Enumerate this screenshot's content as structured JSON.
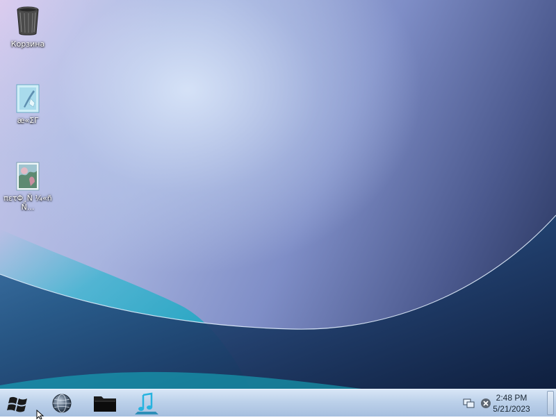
{
  "desktop": {
    "icons": [
      {
        "label": "Корзина",
        "icon": "recycle-bin-icon"
      },
      {
        "label": "æ«ΣΓ",
        "icon": "document-icon"
      },
      {
        "label": "πετΦ¸Ñ ¼«ñÑ...",
        "icon": "image-file-icon"
      }
    ]
  },
  "taskbar": {
    "start_icon": "windows-logo-icon",
    "pinned": [
      {
        "icon": "globe-browser-icon"
      },
      {
        "icon": "folder-icon"
      },
      {
        "icon": "music-note-icon"
      }
    ],
    "tray": {
      "icons": [
        "network-icon",
        "close-circle-icon"
      ],
      "time": "2:48 PM",
      "date": "5/21/2023"
    }
  },
  "colors": {
    "taskbar": "#bcd1ea",
    "clock_text": "#1b2733",
    "desktop_dark": "#1e2b50",
    "desktop_teal": "#1fb6c9"
  }
}
